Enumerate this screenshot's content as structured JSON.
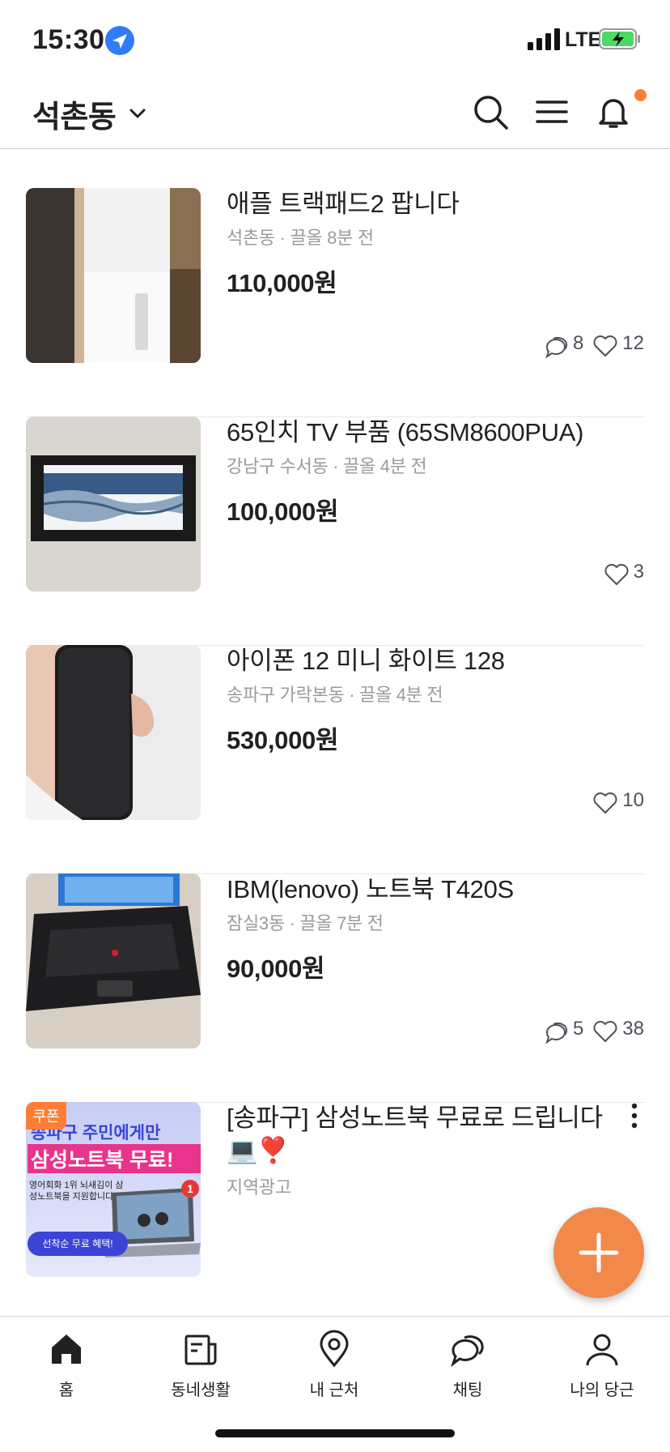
{
  "status_bar": {
    "time": "15:30",
    "network": "LTE"
  },
  "header": {
    "location": "석촌동"
  },
  "items": [
    {
      "title": "애플 트랙패드2 팝니다",
      "meta": "석촌동 · 끌올 8분 전",
      "price": "110,000원",
      "comments": "8",
      "likes": "12"
    },
    {
      "title": "65인치 TV 부품 (65SM8600PUA)",
      "meta": "강남구 수서동 · 끌올 4분 전",
      "price": "100,000원",
      "likes": "3"
    },
    {
      "title": "아이폰 12 미니 화이트 128",
      "meta": "송파구 가락본동 · 끌올 4분 전",
      "price": "530,000원",
      "likes": "10"
    },
    {
      "title": "IBM(lenovo) 노트북 T420S",
      "meta": "잠실3동 · 끌올 7분 전",
      "price": "90,000원",
      "comments": "5",
      "likes": "38"
    }
  ],
  "ad": {
    "title": "[송파구] 삼성노트북 무료로 드립니다💻❣️",
    "meta": "지역광고",
    "badge": "쿠폰",
    "banner_line1": "송파구 주민에게만",
    "banner_line2": "삼성노트북 무료!",
    "banner_body": "영어회화 1위 뇌새김이 삼성노트북을 지원합니다.",
    "banner_cta": "선착순 무료 혜택!",
    "banner_notification": "1"
  },
  "tabs": [
    {
      "label": "홈"
    },
    {
      "label": "동네생활"
    },
    {
      "label": "내 근처"
    },
    {
      "label": "채팅"
    },
    {
      "label": "나의 당근"
    }
  ],
  "colors": {
    "accent": "#ff7e36",
    "text": "#212124",
    "muted": "#9a9ba0"
  }
}
